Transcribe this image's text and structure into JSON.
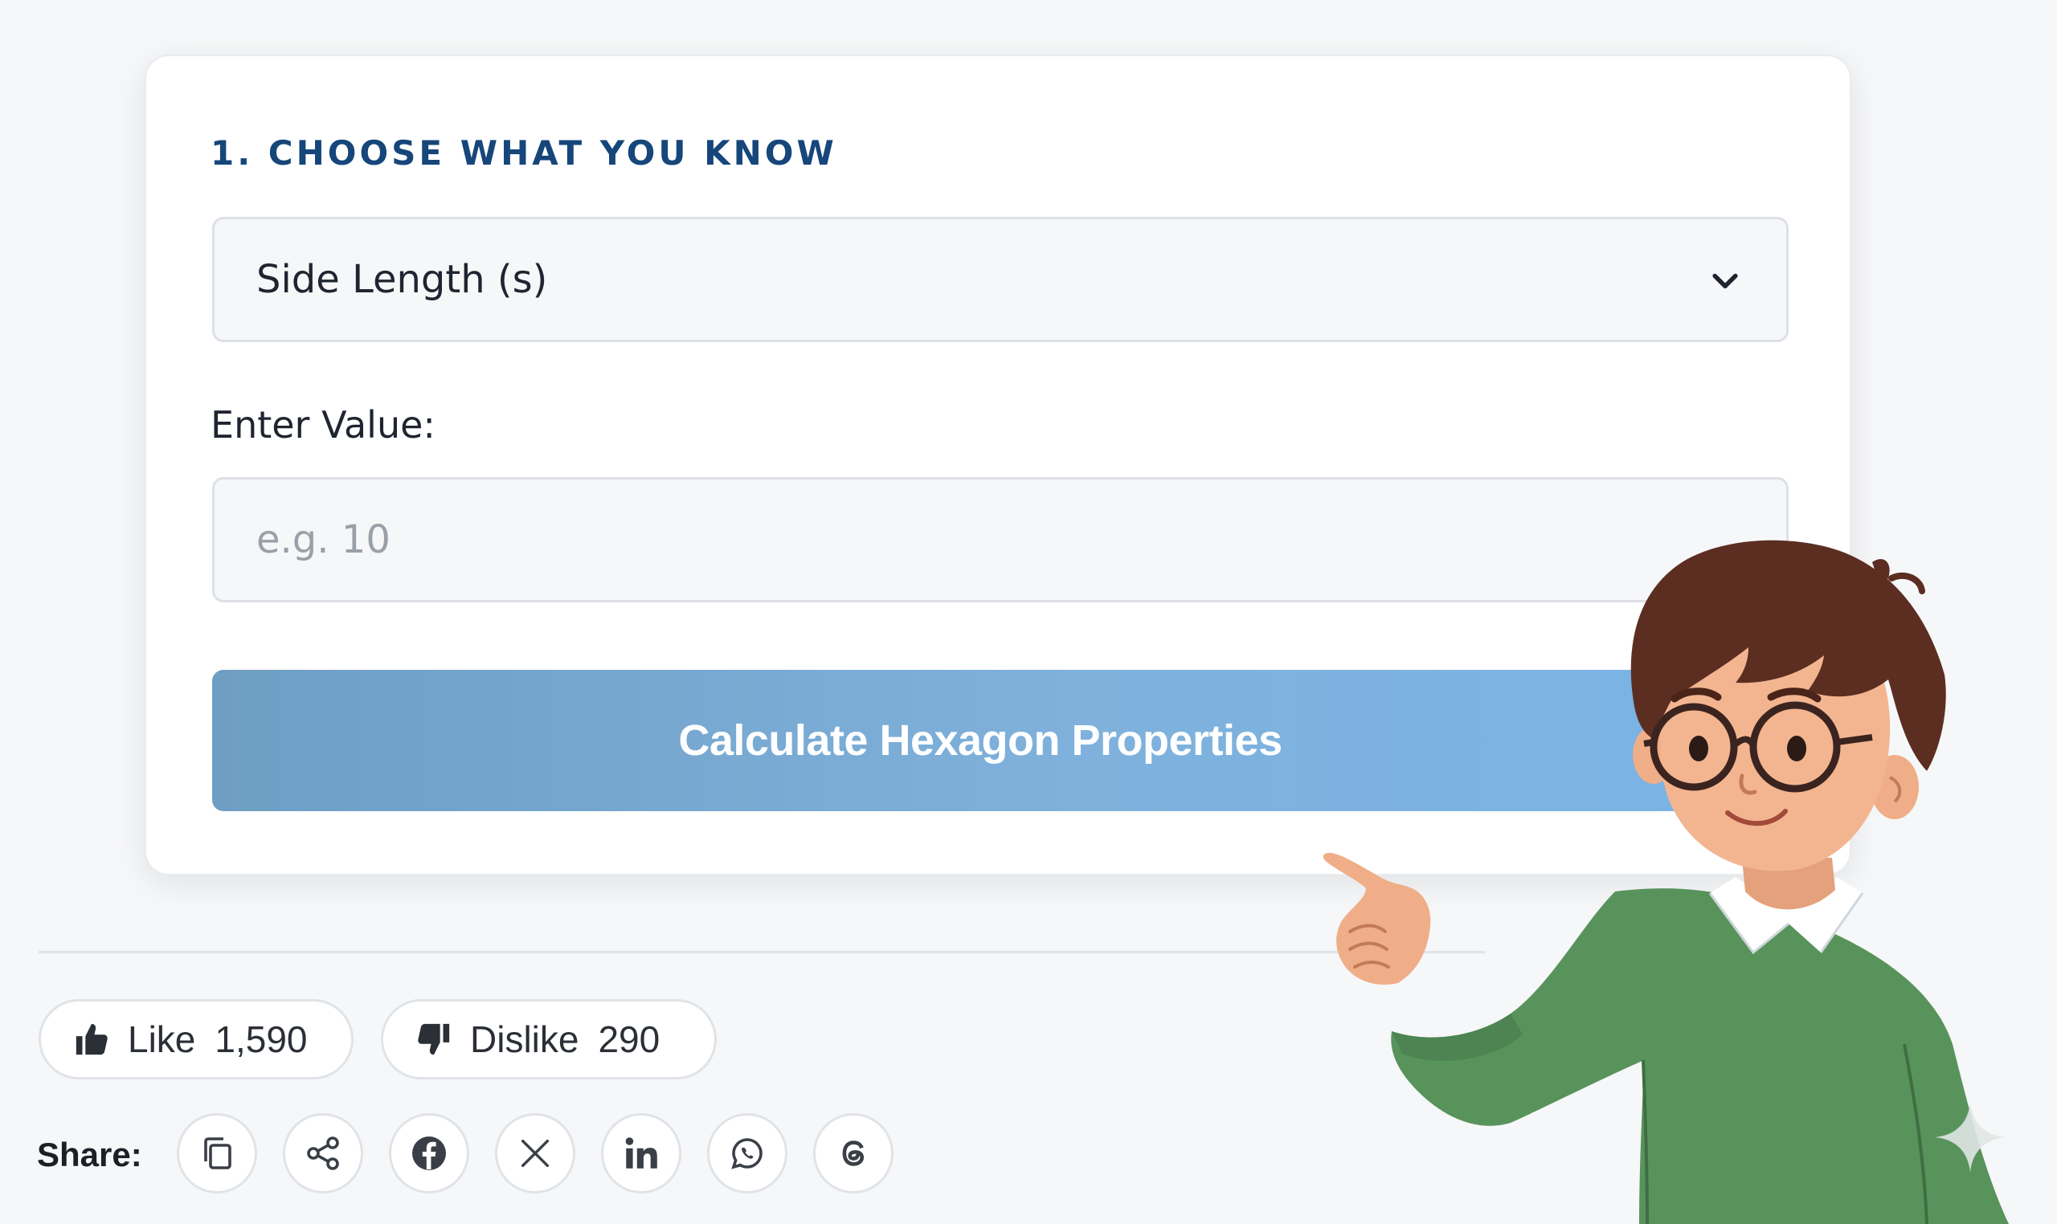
{
  "calculator": {
    "section_title": "1. CHOOSE WHAT YOU KNOW",
    "select": {
      "selected": "Side Length (s)"
    },
    "value_field": {
      "label": "Enter Value:",
      "placeholder": "e.g. 10",
      "value": ""
    },
    "calculate_label": "Calculate Hexagon Properties",
    "accent_color": "#16467a",
    "button_color": "#7fb1dc"
  },
  "feedback": {
    "like_label": "Like",
    "like_count": "1,590",
    "dislike_label": "Dislike",
    "dislike_count": "290"
  },
  "share": {
    "label": "Share:",
    "buttons": [
      "copy-icon",
      "share-icon",
      "facebook-icon",
      "x-icon",
      "linkedin-icon",
      "whatsapp-icon",
      "threads-icon"
    ]
  },
  "mascot": {
    "description_icon": "pointing-boy-illustration"
  }
}
